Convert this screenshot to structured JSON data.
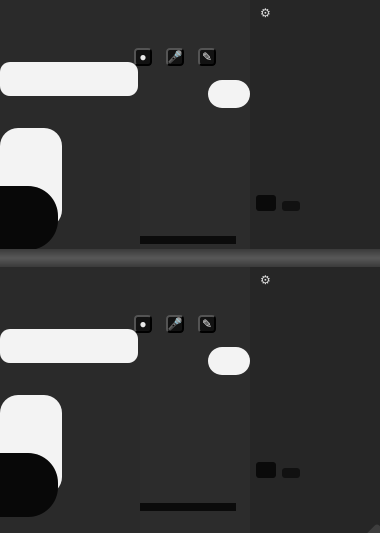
{
  "panels": [
    {
      "id": "top",
      "nav": [
        "",
        ""
      ],
      "selected": "",
      "left_small": "",
      "mid_title": "",
      "mid_tools": [
        "",
        "",
        ""
      ],
      "mid_lines": [
        "",
        ""
      ],
      "right_items": [
        "",
        "",
        ""
      ],
      "right_foot": ""
    },
    {
      "id": "bottom",
      "nav": [
        "",
        ""
      ],
      "selected": "",
      "left_small": "",
      "mid_title": "",
      "mid_tools": [
        "",
        "",
        ""
      ],
      "mid_lines": [
        "",
        ""
      ],
      "right_items": [
        "",
        "",
        ""
      ],
      "right_foot": ""
    }
  ],
  "colors": {
    "background": "#2b2b2b",
    "panel": "#2f2f2f",
    "highlight": "#f3f3f3",
    "dark": "#0b0b0b"
  },
  "icons": {
    "top_right": "settings-icon",
    "toolbar": [
      "record-icon",
      "mic-icon",
      "edit-icon"
    ]
  }
}
